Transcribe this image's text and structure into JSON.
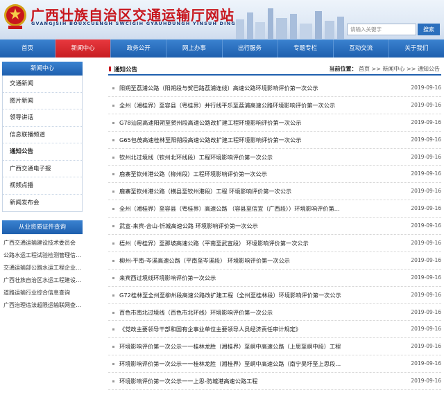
{
  "header": {
    "title": "广西壮族自治区交通运输厅网站",
    "subtitle": "GVANGJSIH BOUXCUENGH SWCIGIH GYAUHDUNGH YINSUH DINGH",
    "search_placeholder": "请输入关键字",
    "search_button": "搜索"
  },
  "nav": [
    "首页",
    "新闻中心",
    "政务公开",
    "网上办事",
    "出行服务",
    "专题专栏",
    "互动交流",
    "关于我们"
  ],
  "sidebar": {
    "heading": "新闻中心",
    "items": [
      "交通新闻",
      "图片新闻",
      "领导讲话",
      "信息联播频道",
      "通知公告",
      "广西交通电子报",
      "视频点播",
      "新闻发布会"
    ],
    "heading2": "从业资质证件查询",
    "links": [
      "广西交通运输建设技术委员会",
      "公路水运工程试验检测管理信…",
      "交通运输部公路水运工程企业…",
      "广西壮族自治区水运工程建设…",
      "道路运输行业综合信息查询",
      "广西治理违法超限运输联网查…"
    ]
  },
  "main": {
    "title": "通知公告",
    "breadcrumb_label": "当前位置：",
    "breadcrumb": "首页 >> 新闻中心 >> 通知公告",
    "rows": [
      {
        "title": "阳朔至荔浦公路（阳朔段与贺巴路荔浦连线）高速公路环境影响评价第一次公示",
        "date": "2019-09-16"
      },
      {
        "title": "全州（湘桂界）至容县（粤桂界）并行线平乐至荔浦高速公路环境影响评价第一次公示",
        "date": "2019-09-16"
      },
      {
        "title": "G78汕昆高速阳朔至贺州段高速公路改扩建工程环境影响评价第一次公示",
        "date": "2019-09-16"
      },
      {
        "title": "G65包茂高速桂林至阳朔段高速公路改扩建工程环境影响评价第一次公示",
        "date": "2019-09-16"
      },
      {
        "title": "钦州北过境线（钦州北环线段）工程环境影响评价第一次公示",
        "date": "2019-09-16"
      },
      {
        "title": "鹿寨至钦州港公路（柳州段）工程环境影响评价第一次公示",
        "date": "2019-09-16"
      },
      {
        "title": "鹿寨至钦州港公路（横县至钦州港段）工程 环境影响评价第一次公示",
        "date": "2019-09-16"
      },
      {
        "title": "全州（湘桂界）至容县（粤桂界）高速公路 （容县至信宜（广西段））环境影响评价第…",
        "date": "2019-09-16"
      },
      {
        "title": "武宣-来宾-合山-忻城高速公路 环境影响评价第一次公示",
        "date": "2019-09-16"
      },
      {
        "title": "梧州（粤桂界）至那坡高速公路（平南至武宣段） 环境影响评价第一次公示",
        "date": "2019-09-16"
      },
      {
        "title": "柳州-平南-岑溪高速公路（平南至岑溪段） 环境影响评价第一次公示",
        "date": "2019-09-16"
      },
      {
        "title": "来宾西过境线环境影响评价第一次公示",
        "date": "2019-09-16"
      },
      {
        "title": "G72桂林至全州至柳州段高速公路改扩建工程（全州至桂林段）环境影响评价第一次公示",
        "date": "2019-09-16"
      },
      {
        "title": "百色市南北过境线（百色市北环线）环境影响评价第一次公示",
        "date": "2019-09-16"
      },
      {
        "title": "《党政主要领导干部和国有企事业单位主要领导人员经济责任审计规定》",
        "date": "2019-09-16"
      },
      {
        "title": "环境影响评价第一次公示一一桂林龙胜（湘桂界）至峒中高速公路（上思至峒中段）工程",
        "date": "2019-09-16"
      },
      {
        "title": "环境影响评价第一次公示一一桂林龙胜（湘桂界）至峒中高速公路（南宁吴圩至上思段…",
        "date": "2019-09-16"
      },
      {
        "title": "环境影响评价第一次公示一一上思-防城港高速公路工程",
        "date": "2019-09-16"
      }
    ]
  },
  "colors": {
    "brand_red": "#c8161d",
    "nav_blue": "#1e5fae"
  }
}
